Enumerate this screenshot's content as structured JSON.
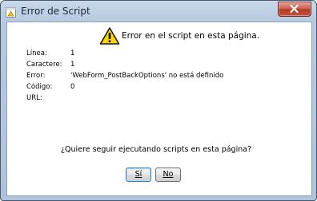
{
  "window": {
    "title": "Error de Script",
    "header_message": "Error en el script en esta página."
  },
  "details": [
    {
      "label": "Línea:",
      "value": "1"
    },
    {
      "label": "Caractere:",
      "value": "1"
    },
    {
      "label": "Error:",
      "value": "'WebForm_PostBackOptions' no está definido"
    },
    {
      "label": "Código:",
      "value": "0"
    },
    {
      "label": "URL:",
      "value": ""
    }
  ],
  "question": "¿Quiere seguir ejecutando scripts en esta página?",
  "buttons": {
    "yes": "Sí",
    "no": "No"
  },
  "icons": {
    "title_icon": "script-error-icon",
    "warning": "warning-icon",
    "close": "close-icon"
  }
}
